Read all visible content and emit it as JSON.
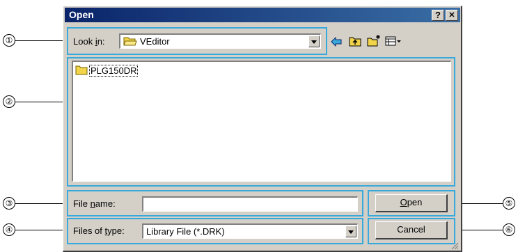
{
  "dialog": {
    "title": "Open",
    "help_button": "?",
    "close_button": "✕"
  },
  "look_in": {
    "label_pre": "Look ",
    "label_u": "i",
    "label_post": "n:",
    "value": "VEditor"
  },
  "file_list": [
    {
      "name": "PLG150DR",
      "type": "folder"
    }
  ],
  "file_name": {
    "label_pre": "File ",
    "label_u": "n",
    "label_post": "ame:",
    "value": ""
  },
  "files_of_type": {
    "label_pre": "Files of ",
    "label_u": "t",
    "label_post": "ype:",
    "value": "Library File (*.DRK)"
  },
  "buttons": {
    "open_u": "O",
    "open_rest": "pen",
    "cancel": "Cancel"
  },
  "callouts": [
    "①",
    "②",
    "③",
    "④",
    "⑤",
    "⑥"
  ],
  "colors": {
    "titlebar_start": "#0a246a",
    "titlebar_end": "#3a6ea5",
    "callout": "#39a9dc",
    "folder": "#f2d44a"
  }
}
